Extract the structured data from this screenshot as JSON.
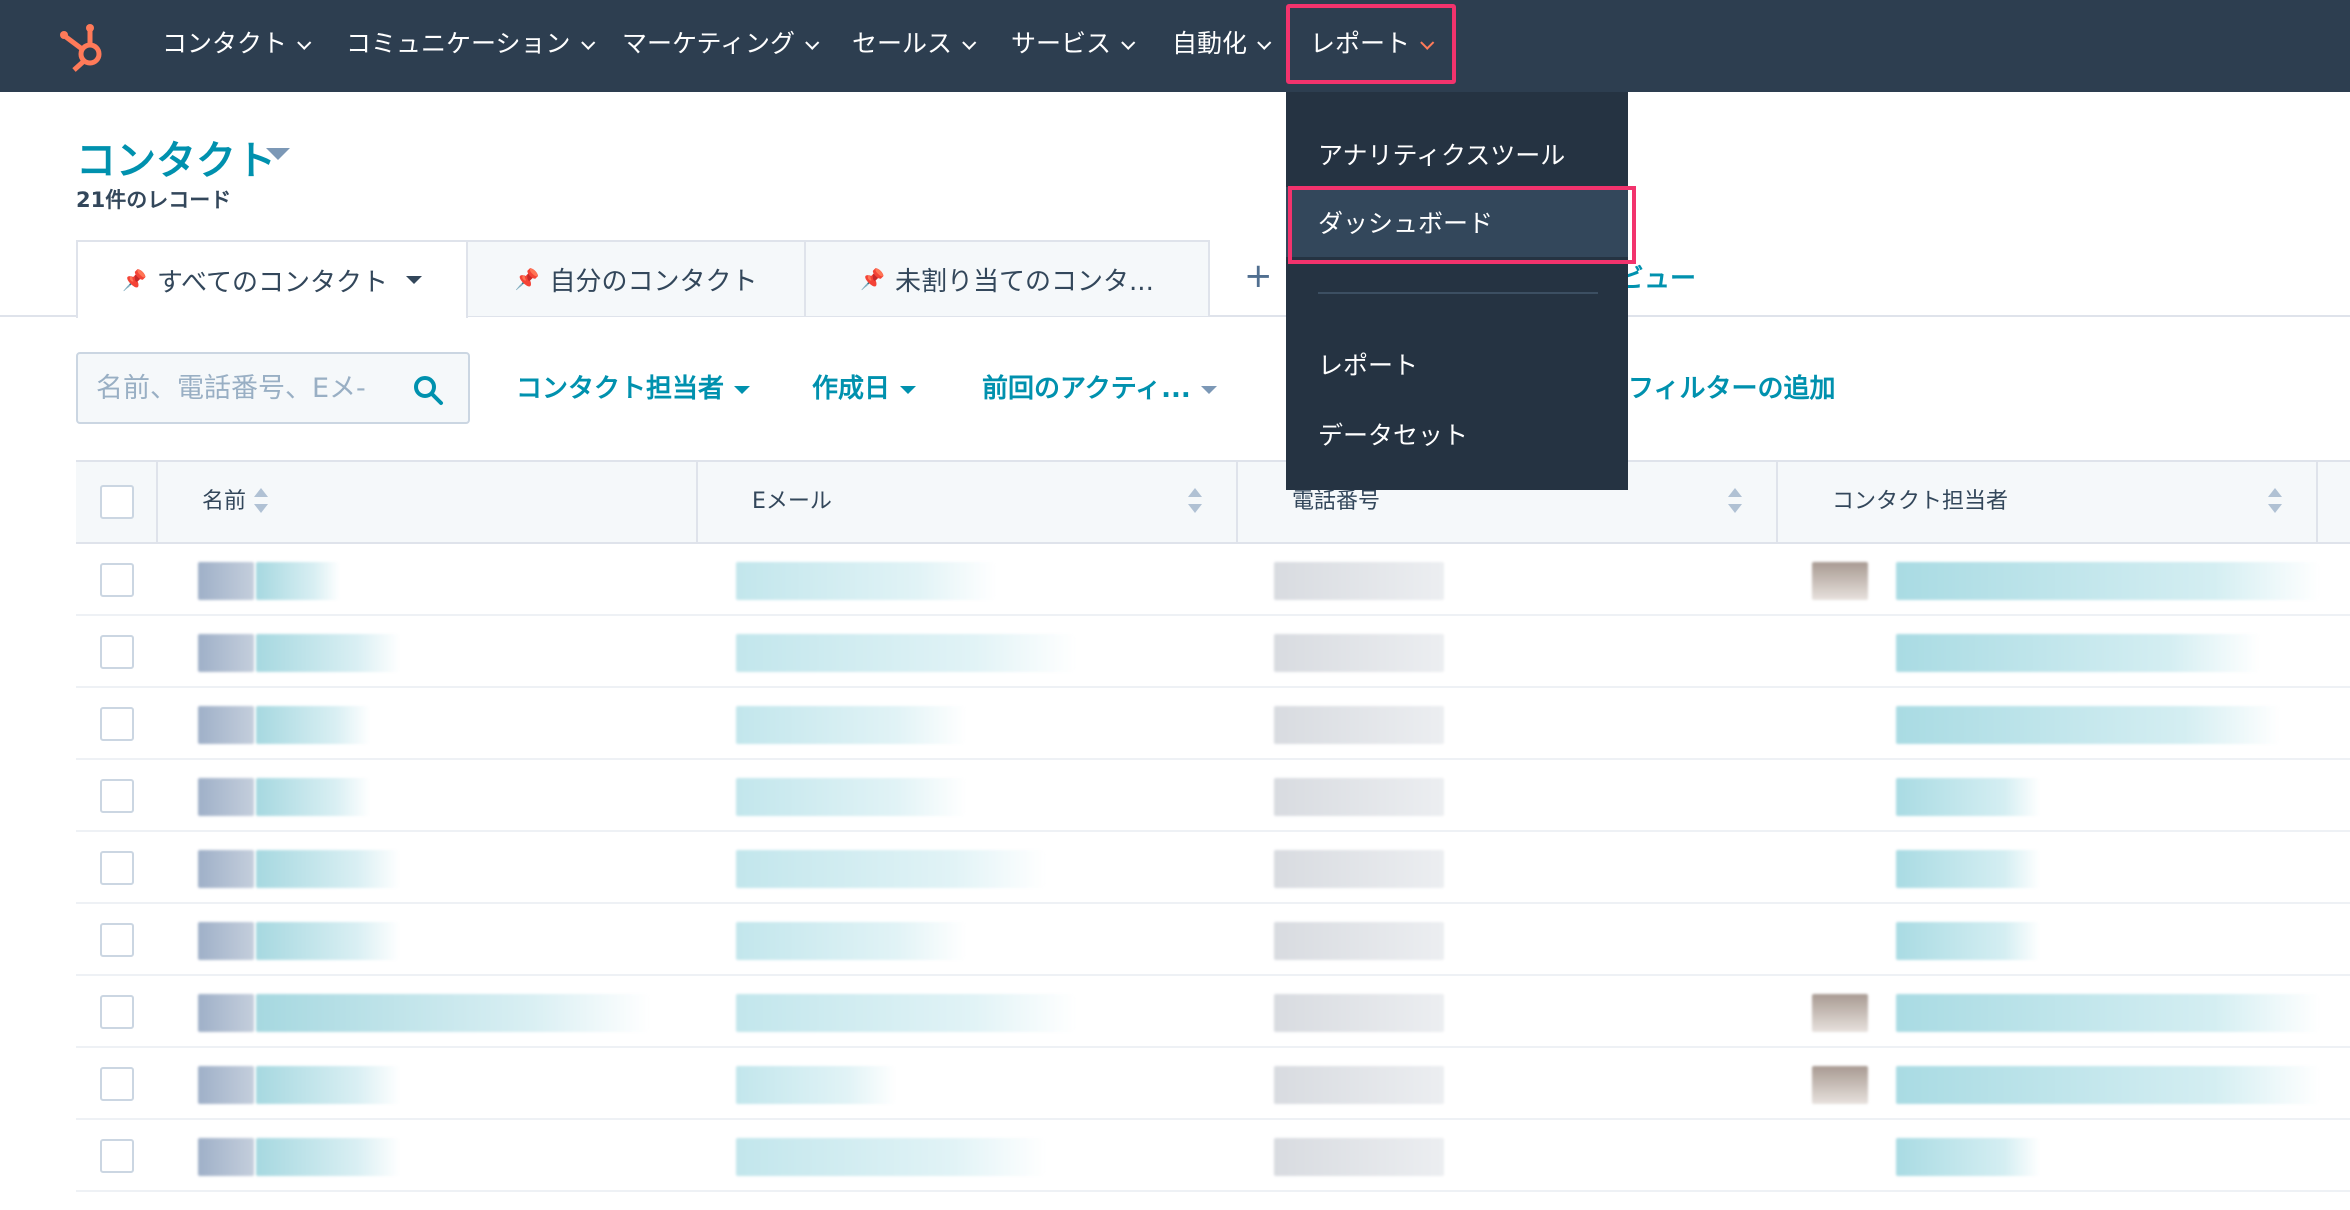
{
  "nav": {
    "items": [
      {
        "label": "コンタクト"
      },
      {
        "label": "コミュニケーション"
      },
      {
        "label": "マーケティング"
      },
      {
        "label": "セールス"
      },
      {
        "label": "サービス"
      },
      {
        "label": "自動化"
      },
      {
        "label": "レポート"
      }
    ],
    "active_index": 6
  },
  "report_menu": {
    "items": [
      {
        "label": "アナリティクスツール"
      },
      {
        "label": "ダッシュボード"
      },
      {
        "label": "レポート"
      },
      {
        "label": "データセット"
      }
    ],
    "highlighted": "ダッシュボード"
  },
  "page": {
    "title": "コンタクト",
    "record_count": "21件のレコード"
  },
  "view_tabs": [
    {
      "label": "すべてのコンタクト"
    },
    {
      "label": "自分のコンタクト"
    },
    {
      "label": "未割り当てのコンタ..."
    }
  ],
  "view_link": "ビュー",
  "search": {
    "placeholder": "名前、電話番号、Eメ-"
  },
  "filters": [
    {
      "label": "コンタクト担当者"
    },
    {
      "label": "作成日"
    },
    {
      "label": "前回のアクティ..."
    },
    {
      "label": "フィルターの追加"
    }
  ],
  "table": {
    "columns": [
      "名前",
      "Eメール",
      "電話番号",
      "コンタクト担当者"
    ],
    "row_count": 9
  },
  "colors": {
    "nav_bg": "#2d3e50",
    "menu_bg": "#253342",
    "accent": "#0091ae",
    "highlight": "#f2336d"
  }
}
